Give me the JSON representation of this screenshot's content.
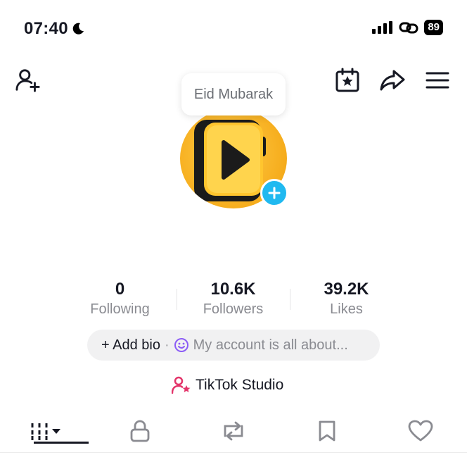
{
  "status_bar": {
    "time": "07:40",
    "battery": "89",
    "icons": [
      "moon-icon",
      "signal-icon",
      "link-icon",
      "battery-icon"
    ]
  },
  "header": {
    "icons": [
      "add-friend-icon",
      "calendar-star-icon",
      "share-icon",
      "menu-icon"
    ]
  },
  "profile": {
    "bubble_text": "Eid Mubarak",
    "avatar_icon": "video-play-icon"
  },
  "stats": [
    {
      "value": "0",
      "label": "Following"
    },
    {
      "value": "10.6K",
      "label": "Followers"
    },
    {
      "value": "39.2K",
      "label": "Likes"
    }
  ],
  "bio": {
    "add_label": "+ Add bio",
    "separator": "·",
    "placeholder": "My account is all about..."
  },
  "studio": {
    "label": "TikTok Studio"
  },
  "tabs": [
    "videos-grid-icon",
    "lock-icon",
    "repost-icon",
    "bookmark-icon",
    "heart-icon"
  ],
  "colors": {
    "avatar": "#f6ad1d",
    "add_button": "#20b9f0",
    "studio_icon": "#e3346a",
    "smiley": "#8b5cf6"
  }
}
